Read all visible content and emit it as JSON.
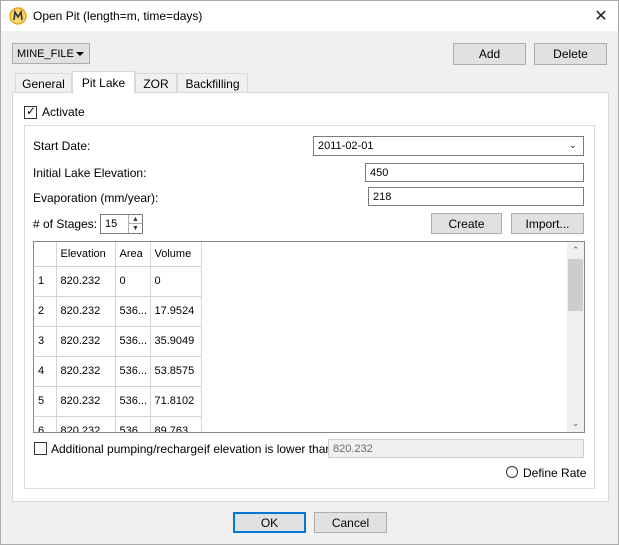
{
  "window": {
    "title": "Open Pit (length=m, time=days)"
  },
  "toolbar": {
    "file_select": "MINE_FILE",
    "add_label": "Add",
    "delete_label": "Delete"
  },
  "tabs": [
    {
      "label": "General",
      "active": false
    },
    {
      "label": "Pit Lake",
      "active": true
    },
    {
      "label": "ZOR",
      "active": false
    },
    {
      "label": "Backfilling",
      "active": false
    }
  ],
  "pit_lake": {
    "activate_label": "Activate",
    "activate_checked": true,
    "start_date_label": "Start Date:",
    "start_date_value": "2011-02-01",
    "initial_elev_label": "Initial Lake Elevation:",
    "initial_elev_value": "450",
    "evaporation_label": "Evaporation (mm/year):",
    "evaporation_value": "218",
    "stages_label": "# of Stages:",
    "stages_value": "15",
    "create_label": "Create",
    "import_label": "Import...",
    "table": {
      "columns": [
        "",
        "Elevation",
        "Area",
        "Volume"
      ],
      "rows": [
        [
          "1",
          "820.232",
          "0",
          "0"
        ],
        [
          "2",
          "820.232",
          "536...",
          "17.9524"
        ],
        [
          "3",
          "820.232",
          "536...",
          "35.9049"
        ],
        [
          "4",
          "820.232",
          "536...",
          "53.8575"
        ],
        [
          "5",
          "820.232",
          "536...",
          "71.8102"
        ],
        [
          "6",
          "820.232",
          "536...",
          "89.763"
        ]
      ]
    },
    "pumping_label": "Additional pumping/recharge,",
    "if_lower_label": "if elevation is lower than",
    "if_lower_value": "820.232",
    "define_rate_label": "Define Rate"
  },
  "footer": {
    "ok_label": "OK",
    "cancel_label": "Cancel"
  },
  "colors": {
    "accent": "#0078d7",
    "app_icon": "#e8a21a"
  }
}
